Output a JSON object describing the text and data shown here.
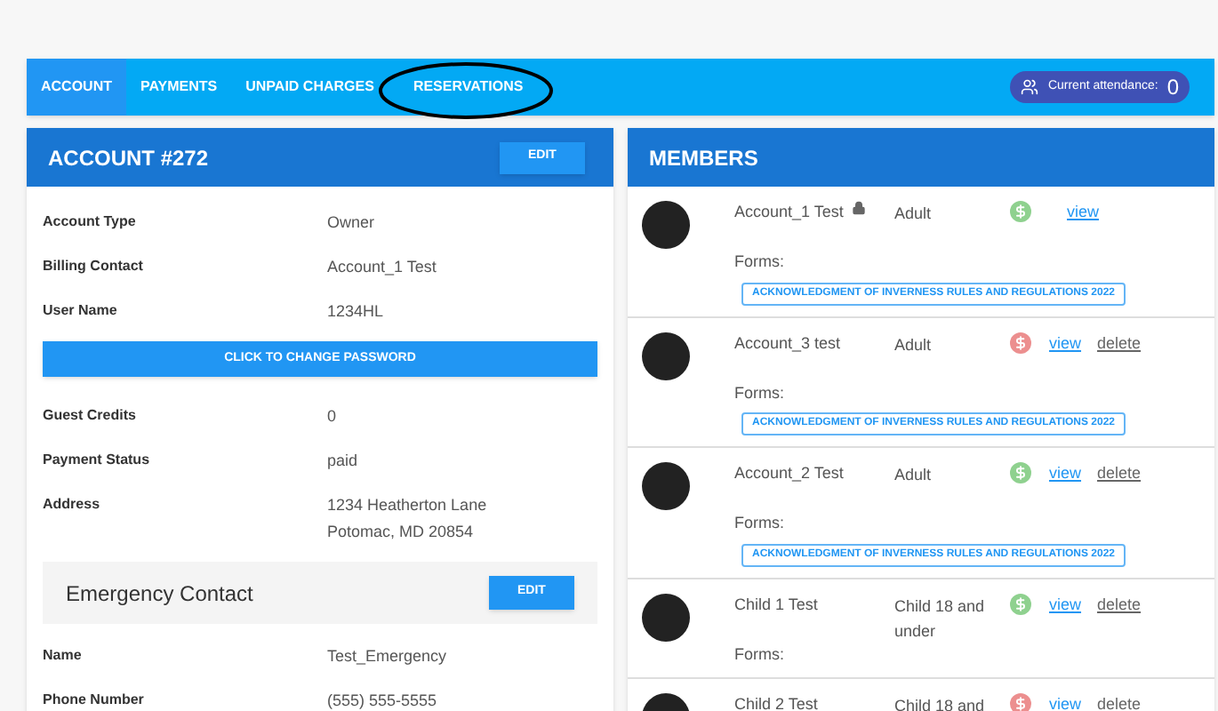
{
  "nav": {
    "tabs": [
      {
        "label": "ACCOUNT",
        "selected": true,
        "circled": false
      },
      {
        "label": "PAYMENTS",
        "selected": false,
        "circled": false
      },
      {
        "label": "UNPAID CHARGES",
        "selected": false,
        "circled": false
      },
      {
        "label": "RESERVATIONS",
        "selected": false,
        "circled": true
      }
    ],
    "attendance": {
      "label": "Current attendance:",
      "count": "0"
    }
  },
  "account": {
    "title": "ACCOUNT #272",
    "edit": "EDIT",
    "fields": [
      {
        "label": "Account Type",
        "value": [
          "Owner"
        ]
      },
      {
        "label": "Billing Contact",
        "value": [
          "Account_1 Test"
        ]
      },
      {
        "label": "User Name",
        "value": [
          "1234HL"
        ]
      }
    ],
    "password_button": "CLICK TO CHANGE PASSWORD",
    "fields_2": [
      {
        "label": "Guest Credits",
        "value": [
          "0"
        ]
      },
      {
        "label": "Payment Status",
        "value": [
          "paid"
        ]
      },
      {
        "label": "Address",
        "value": [
          "1234 Heatherton Lane",
          "Potomac, MD 20854"
        ]
      }
    ],
    "emergency": {
      "title": "Emergency Contact",
      "edit": "EDIT",
      "fields": [
        {
          "label": "Name",
          "value": [
            "Test_Emergency"
          ]
        },
        {
          "label": "Phone Number",
          "value": [
            "(555) 555-5555"
          ]
        }
      ]
    }
  },
  "members": {
    "title": "MEMBERS",
    "items": [
      {
        "name": "Account_1 Test",
        "locked": true,
        "type": "Adult",
        "paid": true,
        "view": "view",
        "forms_label": "Forms:",
        "forms": [
          "ACKNOWLEDGMENT OF INVERNESS RULES AND REGULATIONS 2022"
        ]
      },
      {
        "name": "Account_3 test",
        "locked": false,
        "type": "Adult",
        "paid": false,
        "view": "view",
        "delete": "delete",
        "forms_label": "Forms:",
        "forms": [
          "ACKNOWLEDGMENT OF INVERNESS RULES AND REGULATIONS 2022"
        ]
      },
      {
        "name": "Account_2 Test",
        "locked": false,
        "type": "Adult",
        "paid": true,
        "view": "view",
        "delete": "delete",
        "forms_label": "Forms:",
        "forms": [
          "ACKNOWLEDGMENT OF INVERNESS RULES AND REGULATIONS 2022"
        ]
      },
      {
        "name": "Child 1 Test",
        "locked": false,
        "type": "Child 18 and under",
        "paid": true,
        "view": "view",
        "delete": "delete",
        "forms_label": "Forms:"
      },
      {
        "name": "Child 2 Test",
        "locked": false,
        "type": "Child 18 and",
        "paid": false,
        "view": "view",
        "delete": "delete"
      }
    ]
  }
}
